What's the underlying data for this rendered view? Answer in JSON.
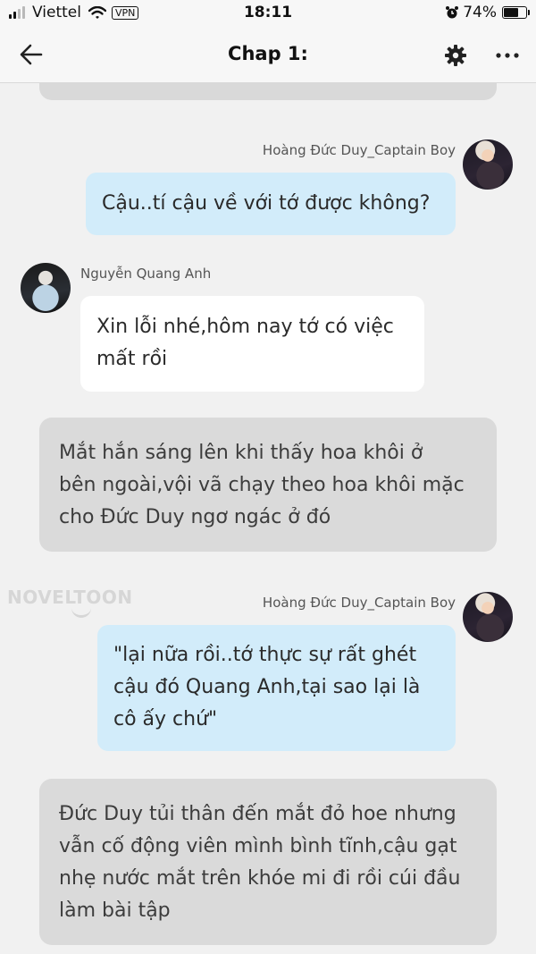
{
  "status_bar": {
    "carrier": "Viettel",
    "vpn": "VPN",
    "time": "18:11",
    "battery_text": "74%",
    "battery_level": 0.74
  },
  "nav": {
    "title": "Chap 1:",
    "icons": [
      "back-arrow-icon",
      "gear-icon",
      "more-icon"
    ]
  },
  "messages": [
    {
      "type": "outgoing",
      "sender": "Hoàng Đức Duy_Captain Boy",
      "text": "Cậu..tí cậu về với tớ được không?"
    },
    {
      "type": "incoming",
      "sender": "Nguyễn Quang Anh",
      "text": "Xin lỗi nhé,hôm nay tớ có việc\nmất rồi"
    },
    {
      "type": "narration",
      "text": "Mắt hắn sáng lên khi thấy hoa khôi ở\nbên ngoài,vội vã chạy theo hoa khôi mặc\ncho Đức Duy ngơ ngác ở đó"
    },
    {
      "type": "outgoing",
      "sender": "Hoàng Đức Duy_Captain Boy",
      "text": "\"lại nữa rồi..tớ thực sự rất ghét\ncậu đó Quang Anh,tại sao lại là\ncô ấy chứ\""
    },
    {
      "type": "narration",
      "text": "Đức Duy tủi thân đến mắt đỏ hoe nhưng\nvẫn cố động viên mình bình tĩnh,cậu gạt\nnhẹ nước mắt trên khóe mi đi rồi cúi đầu\nlàm bài tập"
    }
  ],
  "watermark": "NOVELTOON",
  "colors": {
    "background": "#f1f1f1",
    "outgoing_bubble": "#d2ecfa",
    "incoming_bubble": "#ffffff",
    "narration_bubble": "#dadada"
  }
}
